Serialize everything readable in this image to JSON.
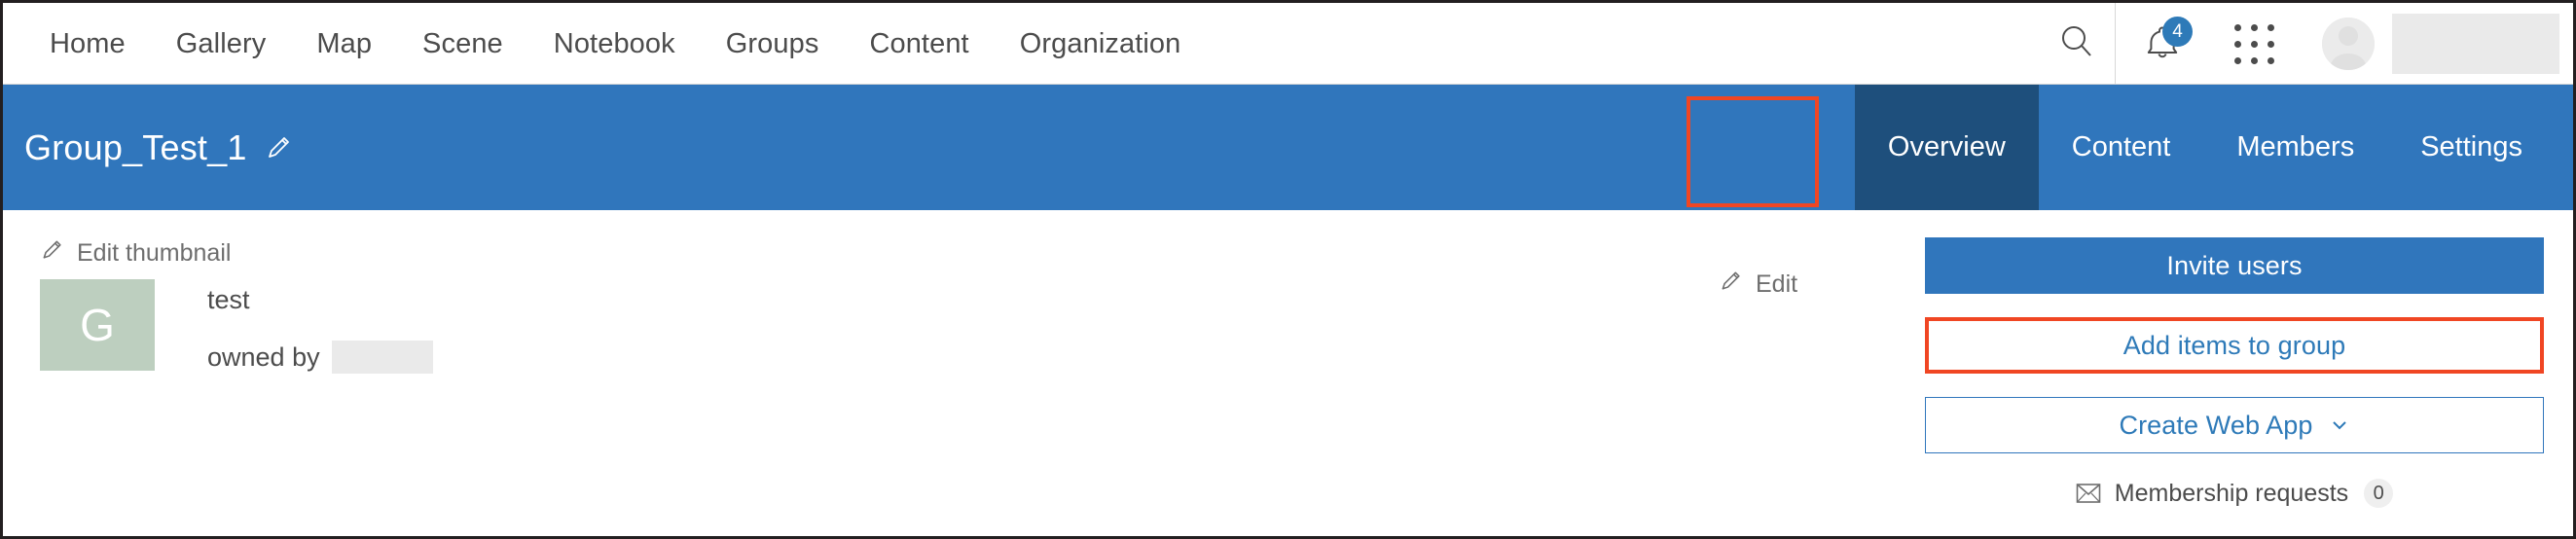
{
  "topnav": {
    "links": [
      {
        "label": "Home"
      },
      {
        "label": "Gallery"
      },
      {
        "label": "Map"
      },
      {
        "label": "Scene"
      },
      {
        "label": "Notebook"
      },
      {
        "label": "Groups"
      },
      {
        "label": "Content"
      },
      {
        "label": "Organization"
      }
    ],
    "search_icon": "search-icon",
    "notifications_icon": "bell-icon",
    "notifications_count": "4",
    "app_switcher_icon": "app-grid-icon",
    "avatar_icon": "user-avatar-icon",
    "username_redacted": ""
  },
  "groupbar": {
    "title": "Group_Test_1",
    "title_edit_icon": "pencil-icon",
    "tabs": [
      {
        "label": "Overview",
        "active": true
      },
      {
        "label": "Content",
        "active": false
      },
      {
        "label": "Members",
        "active": false
      },
      {
        "label": "Settings",
        "active": false
      }
    ]
  },
  "overview": {
    "edit_thumbnail_label": "Edit thumbnail",
    "edit_thumbnail_icon": "pencil-icon",
    "thumbnail_letter": "G",
    "group_name": "test",
    "owned_by_label": "owned by",
    "owner_redacted": "",
    "edit_label": "Edit",
    "edit_icon": "pencil-icon"
  },
  "actions": {
    "invite_users_label": "Invite users",
    "add_items_label": "Add items to group",
    "create_web_app_label": "Create Web App",
    "create_web_app_chevron": "chevron-down-icon",
    "membership_requests_label": "Membership requests",
    "membership_requests_icon": "envelope-icon",
    "membership_requests_count": "0"
  },
  "colors": {
    "brand_blue": "#3076bc",
    "active_tab_blue": "#1e4f7c",
    "highlight_red": "#f04623",
    "thumbnail_green": "#bdcfbf",
    "text_gray": "#4c4c4c"
  }
}
